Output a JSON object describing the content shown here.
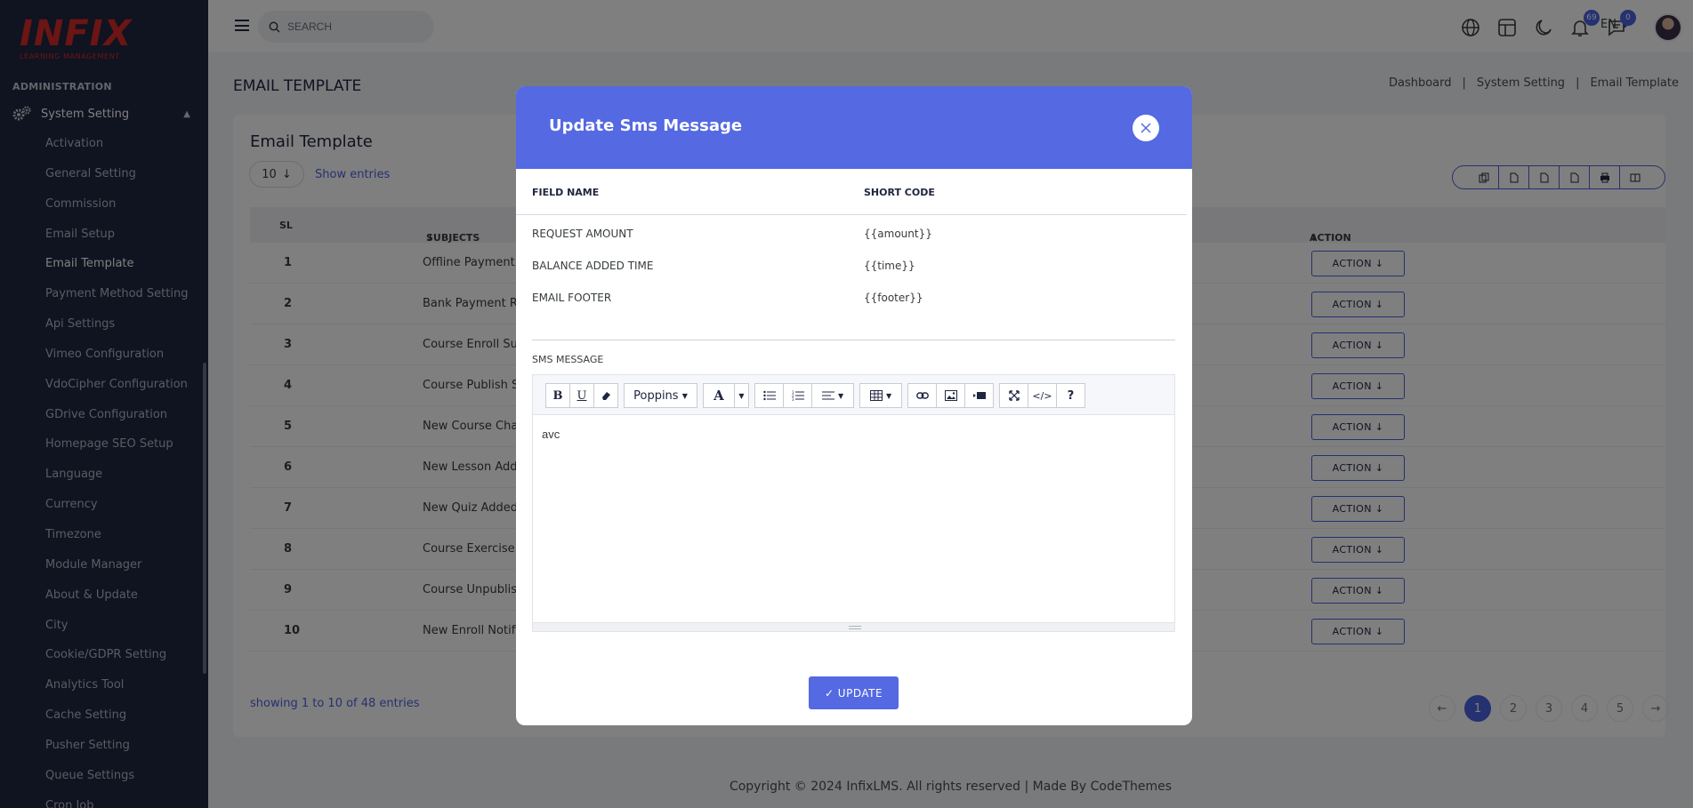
{
  "brand": {
    "logo": "INFIX",
    "tagline": "LEARNING MANAGEMENT"
  },
  "sidebar": {
    "section": "ADMINISTRATION",
    "parent": "System Setting",
    "items": [
      {
        "label": "Activation"
      },
      {
        "label": "General Setting"
      },
      {
        "label": "Commission"
      },
      {
        "label": "Email Setup"
      },
      {
        "label": "Email Template"
      },
      {
        "label": "Payment Method Setting"
      },
      {
        "label": "Api Settings"
      },
      {
        "label": "Vimeo Configuration"
      },
      {
        "label": "VdoCipher Configuration"
      },
      {
        "label": "GDrive Configuration"
      },
      {
        "label": "Homepage SEO Setup"
      },
      {
        "label": "Language"
      },
      {
        "label": "Currency"
      },
      {
        "label": "Timezone"
      },
      {
        "label": "Module Manager"
      },
      {
        "label": "About & Update"
      },
      {
        "label": "City"
      },
      {
        "label": "Cookie/GDPR Setting"
      },
      {
        "label": "Analytics Tool"
      },
      {
        "label": "Cache Setting"
      },
      {
        "label": "Pusher Setting"
      },
      {
        "label": "Queue Settings"
      },
      {
        "label": "Cron Job"
      }
    ]
  },
  "topbar": {
    "search_placeholder": "SEARCH",
    "lang": "EN",
    "notifications_count": "69",
    "messages_count": "0"
  },
  "page": {
    "title": "EMAIL TEMPLATE",
    "breadcrumb": [
      "Dashboard",
      "|",
      "System Setting",
      "|",
      "Email Template"
    ],
    "card_title": "Email Template",
    "entries_value": "10",
    "entries_label": "Show entries",
    "columns": {
      "sl": "SL",
      "subjects": "SUBJECTS",
      "action": "ACTION"
    },
    "rows": [
      {
        "sl": "1",
        "subject": "Offline Payment"
      },
      {
        "sl": "2",
        "subject": "Bank Payment Re"
      },
      {
        "sl": "3",
        "subject": "Course Enroll Suc"
      },
      {
        "sl": "4",
        "subject": "Course Publish S"
      },
      {
        "sl": "5",
        "subject": "New Course Cha"
      },
      {
        "sl": "6",
        "subject": "New Lesson Add"
      },
      {
        "sl": "7",
        "subject": "New Quiz Added"
      },
      {
        "sl": "8",
        "subject": "Course Exercise"
      },
      {
        "sl": "9",
        "subject": "Course Unpublis"
      },
      {
        "sl": "10",
        "subject": "New Enroll Notific"
      }
    ],
    "action_label": "ACTION",
    "showing": "showing 1 to 10 of 48 entries",
    "pages": [
      "1",
      "2",
      "3",
      "4",
      "5"
    ],
    "footer": "Copyright © 2024 InfixLMS. All rights reserved | Made By CodeThemes"
  },
  "modal": {
    "title": "Update Sms Message",
    "col_field": "FIELD NAME",
    "col_code": "SHORT CODE",
    "fields": [
      {
        "name": "REQUEST AMOUNT",
        "code": "{{amount}}"
      },
      {
        "name": "BALANCE ADDED TIME",
        "code": "{{time}}"
      },
      {
        "name": "EMAIL FOOTER",
        "code": "{{footer}}"
      }
    ],
    "sms_label": "SMS MESSAGE",
    "font_name": "Poppins",
    "editor_text": "avc",
    "update_label": "✓ UPDATE"
  },
  "colors": {
    "primary": "#5469e2",
    "sidebar": "#202641",
    "brand_red": "#d62a2a"
  }
}
